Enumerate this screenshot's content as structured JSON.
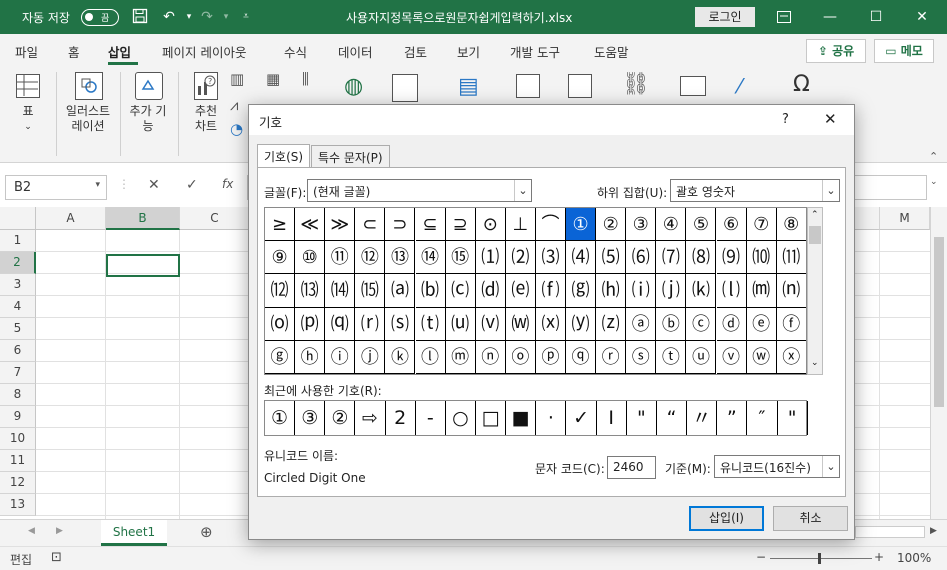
{
  "titlebar": {
    "autosave_label": "자동 저장",
    "toggle_state": "끔",
    "document_title": "사용자지정목록으로원문자쉽게입력하기.xlsx",
    "login_label": "로그인"
  },
  "ribbon_tabs": [
    "파일",
    "홈",
    "삽입",
    "페이지 레이아웃",
    "수식",
    "데이터",
    "검토",
    "보기",
    "개발 도구",
    "도움말"
  ],
  "share": {
    "share_label": "공유",
    "memo_label": "메모"
  },
  "ribbon": {
    "table_label": "표",
    "illustrations_label": "일러스트\n레이션",
    "addins_label": "추가 기\n능",
    "recommended_charts_label": "추천\n차트"
  },
  "formula_bar": {
    "name_box": "B2",
    "fx": "fx"
  },
  "grid": {
    "columns": [
      "A",
      "B",
      "C",
      "D",
      "E",
      "F",
      "G",
      "H",
      "I",
      "J",
      "K",
      "L",
      "M"
    ],
    "rows": [
      "1",
      "2",
      "3",
      "4",
      "5",
      "6",
      "7",
      "8",
      "9",
      "10",
      "11",
      "12",
      "13"
    ],
    "selected_cell": "B2"
  },
  "sheet_tabs": [
    "Sheet1"
  ],
  "statusbar": {
    "mode": "편집",
    "zoom": "100%"
  },
  "dialog": {
    "title": "기호",
    "help": "?",
    "tabs": [
      "기호(S)",
      "특수 문자(P)"
    ],
    "font_label": "글꼴(F):",
    "font_value": "(현재 글꼴)",
    "subset_label": "하위 집합(U):",
    "subset_value": "괄호 영숫자",
    "symbols": [
      [
        "≥",
        "≪",
        "≫",
        "⊂",
        "⊃",
        "⊆",
        "⊇",
        "⊙",
        "⊥",
        "⌒",
        "①",
        "②",
        "③",
        "④",
        "⑤",
        "⑥",
        "⑦",
        "⑧"
      ],
      [
        "⑨",
        "⑩",
        "⑪",
        "⑫",
        "⑬",
        "⑭",
        "⑮",
        "⑴",
        "⑵",
        "⑶",
        "⑷",
        "⑸",
        "⑹",
        "⑺",
        "⑻",
        "⑼",
        "⑽",
        "⑾"
      ],
      [
        "⑿",
        "⒀",
        "⒁",
        "⒂",
        "⒜",
        "⒝",
        "⒞",
        "⒟",
        "⒠",
        "⒡",
        "⒢",
        "⒣",
        "⒤",
        "⒥",
        "⒦",
        "⒧",
        "⒨",
        "⒩"
      ],
      [
        "⒪",
        "⒫",
        "⒬",
        "⒭",
        "⒮",
        "⒯",
        "⒰",
        "⒱",
        "⒲",
        "⒳",
        "⒴",
        "⒵",
        "ⓐ",
        "ⓑ",
        "ⓒ",
        "ⓓ",
        "ⓔ",
        "ⓕ"
      ],
      [
        "ⓖ",
        "ⓗ",
        "ⓘ",
        "ⓙ",
        "ⓚ",
        "ⓛ",
        "ⓜ",
        "ⓝ",
        "ⓞ",
        "ⓟ",
        "ⓠ",
        "ⓡ",
        "ⓢ",
        "ⓣ",
        "ⓤ",
        "ⓥ",
        "ⓦ",
        "ⓧ"
      ]
    ],
    "selected_symbol": "①",
    "recent_label": "최근에 사용한 기호(R):",
    "recent": [
      "①",
      "③",
      "②",
      "⇨",
      "2",
      "-",
      "○",
      "□",
      "■",
      "·",
      "✓",
      "I",
      "\"",
      "“",
      "〃",
      "”",
      "″",
      "\""
    ],
    "unicode_name_label": "유니코드 이름:",
    "unicode_name": "Circled Digit One",
    "char_code_label": "문자 코드(C):",
    "char_code": "2460",
    "basis_label": "기준(M):",
    "basis_value": "유니코드(16진수)",
    "insert_label": "삽입(I)",
    "cancel_label": "취소"
  }
}
